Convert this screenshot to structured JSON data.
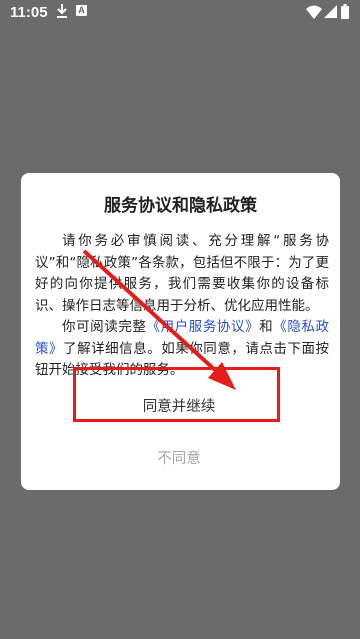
{
  "status_bar": {
    "time": "11:05",
    "a_badge": "A"
  },
  "dialog": {
    "title": "服务协议和隐私政策",
    "para1": "请你务必审慎阅读、充分理解“服务协议”和“隐私政策”各条款，包括但不限于：为了更好的向你提供服务，我们需要收集你的设备标识、操作日志等信息用于分析、优化应用性能。",
    "para2_a": "你可阅读完整",
    "para2_link1": "《用户服务协议》",
    "para2_b": "和",
    "para2_link2": "《隐私政策》",
    "para2_c": "了解详细信息。如果你同意，请点击下面按钮开始接受我们的服务。",
    "agree_label": "同意并继续",
    "disagree_label": "不同意"
  },
  "colors": {
    "link": "#2b4fc9",
    "annotation": "#e41c1c"
  }
}
